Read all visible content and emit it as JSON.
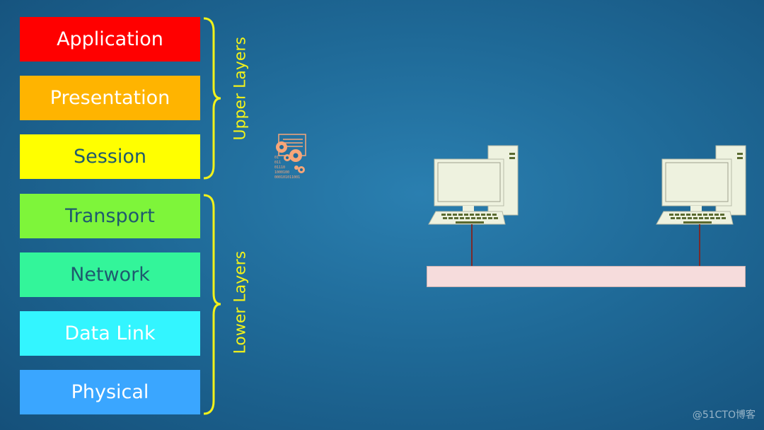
{
  "layers": [
    {
      "label": "Application",
      "bg": "#ff0000",
      "fg": "#ffffff"
    },
    {
      "label": "Presentation",
      "bg": "#ffb400",
      "fg": "#ffffff"
    },
    {
      "label": "Session",
      "bg": "#ffff00",
      "fg": "#1f5a6e"
    },
    {
      "label": "Transport",
      "bg": "#7ef53a",
      "fg": "#1f5a6e"
    },
    {
      "label": "Network",
      "bg": "#33f59a",
      "fg": "#1f5a6e"
    },
    {
      "label": "Data Link",
      "bg": "#33f5ff",
      "fg": "#ffffff"
    },
    {
      "label": "Physical",
      "bg": "#3aa6ff",
      "fg": "#ffffff"
    }
  ],
  "groups": {
    "upper": "Upper Layers",
    "lower": "Lower Layers"
  },
  "colors": {
    "brace": "#f2f21a",
    "computer": "#eef2df",
    "cable": "#7a2a2a",
    "bus": "#f6dcdc",
    "icon": "#f7a679"
  },
  "icons": {
    "process": "gears-binary-document-icon",
    "computer": "desktop-computer-icon"
  },
  "watermark": "@51CTO博客"
}
